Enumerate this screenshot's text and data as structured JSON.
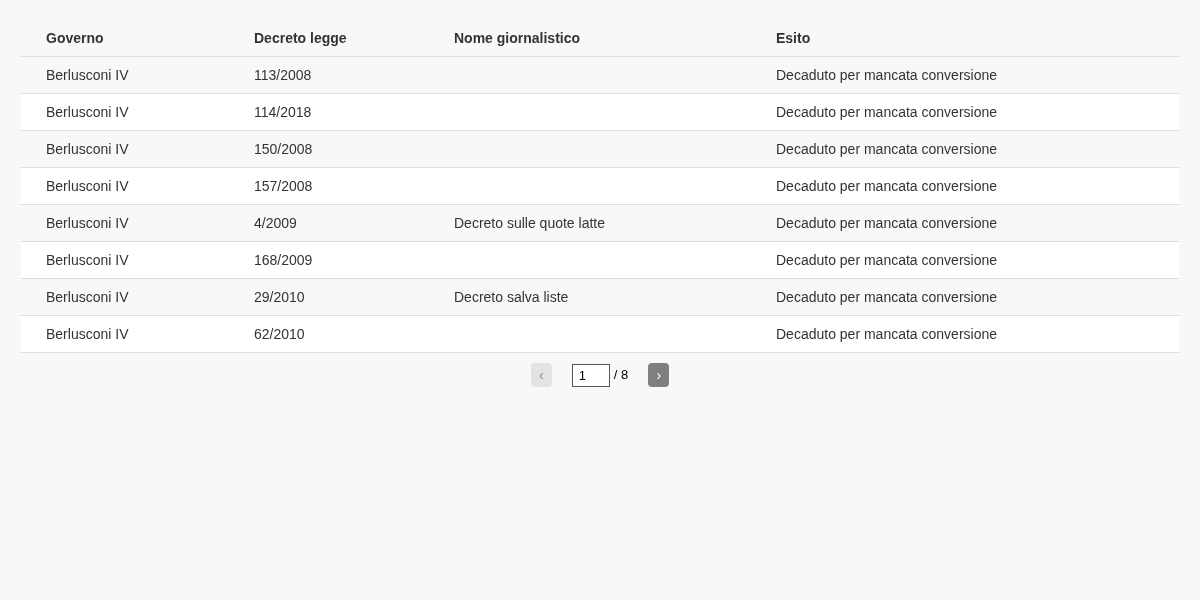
{
  "table": {
    "columns": [
      "Governo",
      "Decreto legge",
      "Nome giornalistico",
      "Esito"
    ],
    "rows": [
      [
        "Berlusconi IV",
        "113/2008",
        "",
        "Decaduto per mancata conversione"
      ],
      [
        "Berlusconi IV",
        "114/2018",
        "",
        "Decaduto per mancata conversione"
      ],
      [
        "Berlusconi IV",
        "150/2008",
        "",
        "Decaduto per mancata conversione"
      ],
      [
        "Berlusconi IV",
        "157/2008",
        "",
        "Decaduto per mancata conversione"
      ],
      [
        "Berlusconi IV",
        "4/2009",
        "Decreto sulle quote latte",
        "Decaduto per mancata conversione"
      ],
      [
        "Berlusconi IV",
        "168/2009",
        "",
        "Decaduto per mancata conversione"
      ],
      [
        "Berlusconi IV",
        "29/2010",
        "Decreto salva liste",
        "Decaduto per mancata conversione"
      ],
      [
        "Berlusconi IV",
        "62/2010",
        "",
        "Decaduto per mancata conversione"
      ]
    ]
  },
  "pagination": {
    "previous": {
      "label": "‹",
      "disabled": true
    },
    "page": "1",
    "total": "/ 8",
    "next": {
      "label": "›",
      "disabled": false
    }
  }
}
